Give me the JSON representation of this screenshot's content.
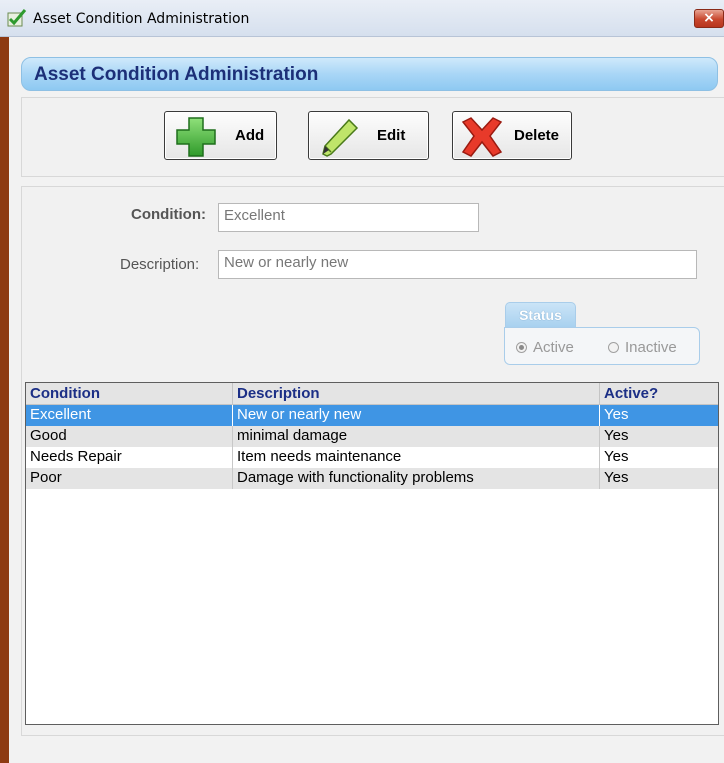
{
  "window": {
    "title": "Asset Condition Administration",
    "close_glyph": "×",
    "icon": "check-icon"
  },
  "header": {
    "title": "Asset Condition Administration"
  },
  "toolbar": {
    "add_label": "Add",
    "edit_label": "Edit",
    "delete_label": "Delete"
  },
  "form": {
    "condition_label": "Condition:",
    "condition_value": "Excellent",
    "description_label": "Description:",
    "description_value": "New or nearly new",
    "status": {
      "title": "Status",
      "active_label": "Active",
      "inactive_label": "Inactive",
      "selected": "Active"
    }
  },
  "grid": {
    "columns": [
      "Condition",
      "Description",
      "Active?"
    ],
    "rows": [
      {
        "condition": "Excellent",
        "description": "New or nearly new",
        "active": "Yes",
        "selected": true
      },
      {
        "condition": "Good",
        "description": "minimal damage",
        "active": "Yes",
        "selected": false
      },
      {
        "condition": "Needs Repair",
        "description": "Item needs maintenance",
        "active": "Yes",
        "selected": false
      },
      {
        "condition": "Poor",
        "description": "Damage with functionality problems",
        "active": "Yes",
        "selected": false
      }
    ]
  },
  "colors": {
    "selection": "#3f95e4",
    "header_text": "#1c2f78",
    "frame": "#8d3a12"
  }
}
